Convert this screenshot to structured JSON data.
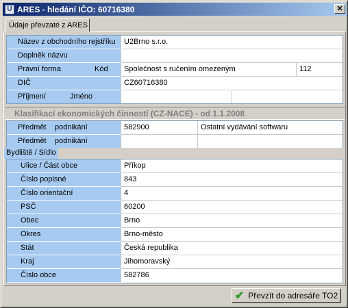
{
  "window": {
    "title": "ARES - hledání IČO: 60716380",
    "close_glyph": "✕",
    "icon_glyph": "U"
  },
  "tab": {
    "label": "Údaje převzaté z ARES"
  },
  "company": {
    "name_label": "Název z obchodního rejstříku",
    "name_value": "U2Brno s.r.o.",
    "addendum_label": "Doplněk názvu",
    "addendum_value": "",
    "legal_form_label": "Právní forma",
    "code_label": "Kód",
    "legal_form_value": "Společnost s ručením omezeným",
    "legal_form_code": "112",
    "dic_label": "DIČ",
    "dic_value": "CZ60716380",
    "surname_label": "Příjmení",
    "firstname_label": "Jméno"
  },
  "nace": {
    "header": "Klasifikací ekonomických činností (CZ-NACE) - od 1.1.2008",
    "rows": [
      {
        "label1": "Předmět",
        "label2": "podnikání",
        "code": "582900",
        "text": "Ostatní vydávání softwaru"
      },
      {
        "label1": "Předmět",
        "label2": "podnikání",
        "code": "",
        "text": ""
      }
    ]
  },
  "address": {
    "header": "Bydliště / Sídlo",
    "rows": [
      {
        "label": "Ulice / Část obce",
        "value": "Příkop"
      },
      {
        "label": "Číslo popisné",
        "value": "843"
      },
      {
        "label": "Číslo orientační",
        "value": "4"
      },
      {
        "label": "PSČ",
        "value": "60200"
      },
      {
        "label": "Obec",
        "value": "Brno"
      },
      {
        "label": "Okres",
        "value": "Brno-město"
      },
      {
        "label": "Stát",
        "value": "Česká republika"
      },
      {
        "label": "Kraj",
        "value": "Jihomoravský"
      },
      {
        "label": "Číslo obce",
        "value": "582786"
      }
    ]
  },
  "footer": {
    "button_label": "Převzít do adresáře TO2",
    "button_icon": "checkmark-icon"
  },
  "colors": {
    "label_bg": "#a6caf0",
    "title_start": "#0a246a",
    "title_end": "#a6caf0"
  }
}
